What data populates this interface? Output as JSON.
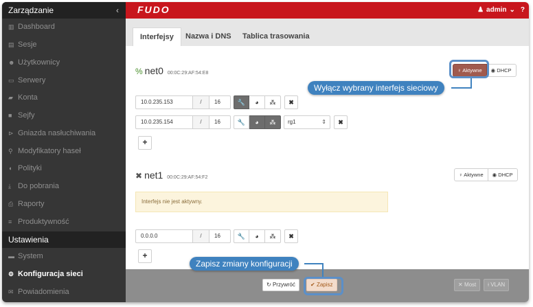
{
  "sidebar": {
    "section_management": "Zarządzanie",
    "collapse_glyph": "‹",
    "management_items": [
      {
        "label": "Dashboard",
        "icon": "dashboard-icon",
        "glyph": "▥"
      },
      {
        "label": "Sesje",
        "icon": "sessions-icon",
        "glyph": "▤"
      },
      {
        "label": "Użytkownicy",
        "icon": "users-icon",
        "glyph": "☻"
      },
      {
        "label": "Serwery",
        "icon": "servers-icon",
        "glyph": "▭"
      },
      {
        "label": "Konta",
        "icon": "accounts-icon",
        "glyph": "▰"
      },
      {
        "label": "Sejfy",
        "icon": "safes-icon",
        "glyph": "■"
      },
      {
        "label": "Gniazda nasłuchiwania",
        "icon": "listeners-icon",
        "glyph": "⊳"
      },
      {
        "label": "Modyfikatory haseł",
        "icon": "password-changers-icon",
        "glyph": "⚲"
      },
      {
        "label": "Polityki",
        "icon": "policies-icon",
        "glyph": "◖"
      },
      {
        "label": "Do pobrania",
        "icon": "downloads-icon",
        "glyph": "⤓"
      },
      {
        "label": "Raporty",
        "icon": "reports-icon",
        "glyph": "⎙"
      },
      {
        "label": "Produktywność",
        "icon": "productivity-icon",
        "glyph": "≡"
      }
    ],
    "section_settings": "Ustawienia",
    "settings_items": [
      {
        "label": "System",
        "icon": "system-icon",
        "glyph": "▬"
      },
      {
        "label": "Konfiguracja sieci",
        "icon": "network-config-icon",
        "glyph": "⚙"
      },
      {
        "label": "Powiadomienia",
        "icon": "notifications-icon",
        "glyph": "✉"
      }
    ]
  },
  "topbar": {
    "logo": "FUDO",
    "user": "admin",
    "user_glyph": "♟",
    "caret": "⌄",
    "help": "?"
  },
  "tabs": [
    "Interfejsy",
    "Nazwa i DNS",
    "Tablica trasowania"
  ],
  "net0": {
    "name": "net0",
    "mac": "00:0C:29:AF:54:E8",
    "status_icon": "link-icon",
    "status_glyph": "%",
    "active_label": "Aktywne",
    "dhcp_label": "DHCP",
    "rows": [
      {
        "ip": "10.0.235.153",
        "slash": "/",
        "mask": "16",
        "wrench_on": true
      },
      {
        "ip": "10.0.235.154",
        "slash": "/",
        "mask": "16",
        "wrench_on": false,
        "select": "rg1"
      }
    ]
  },
  "net1": {
    "name": "net1",
    "mac": "00:0C:29:AF:54:F2",
    "status_icon": "disconnected-icon",
    "status_glyph": "✖",
    "active_label": "Aktywne",
    "dhcp_label": "DHCP",
    "warning": "Interfejs nie jest aktywny.",
    "rows": [
      {
        "ip": "0.0.0.0",
        "slash": "/",
        "mask": "16"
      }
    ]
  },
  "glyphs": {
    "wrench": "🔧",
    "globe": "◕",
    "network": "⁂",
    "delete": "✖",
    "plus": "+",
    "bulb": "♀",
    "dot": "◉",
    "caret": "⇕"
  },
  "bottom": {
    "undo_label": "Przywróć",
    "undo_glyph": "↻",
    "save_label": "Zapisz",
    "save_glyph": "✔",
    "bridge_label": "Most",
    "bridge_glyph": "✕",
    "vlan_label": "VLAN",
    "vlan_glyph": "⟊"
  },
  "callouts": {
    "disable": "Wyłącz wybrany interfejs sieciowy",
    "save": "Zapisz zmiany konfiguracji"
  },
  "colors": {
    "topbar": "#c8161d",
    "sidebar": "#363636",
    "callout": "#3f82bf",
    "active_toggle": "#a05a4e"
  }
}
